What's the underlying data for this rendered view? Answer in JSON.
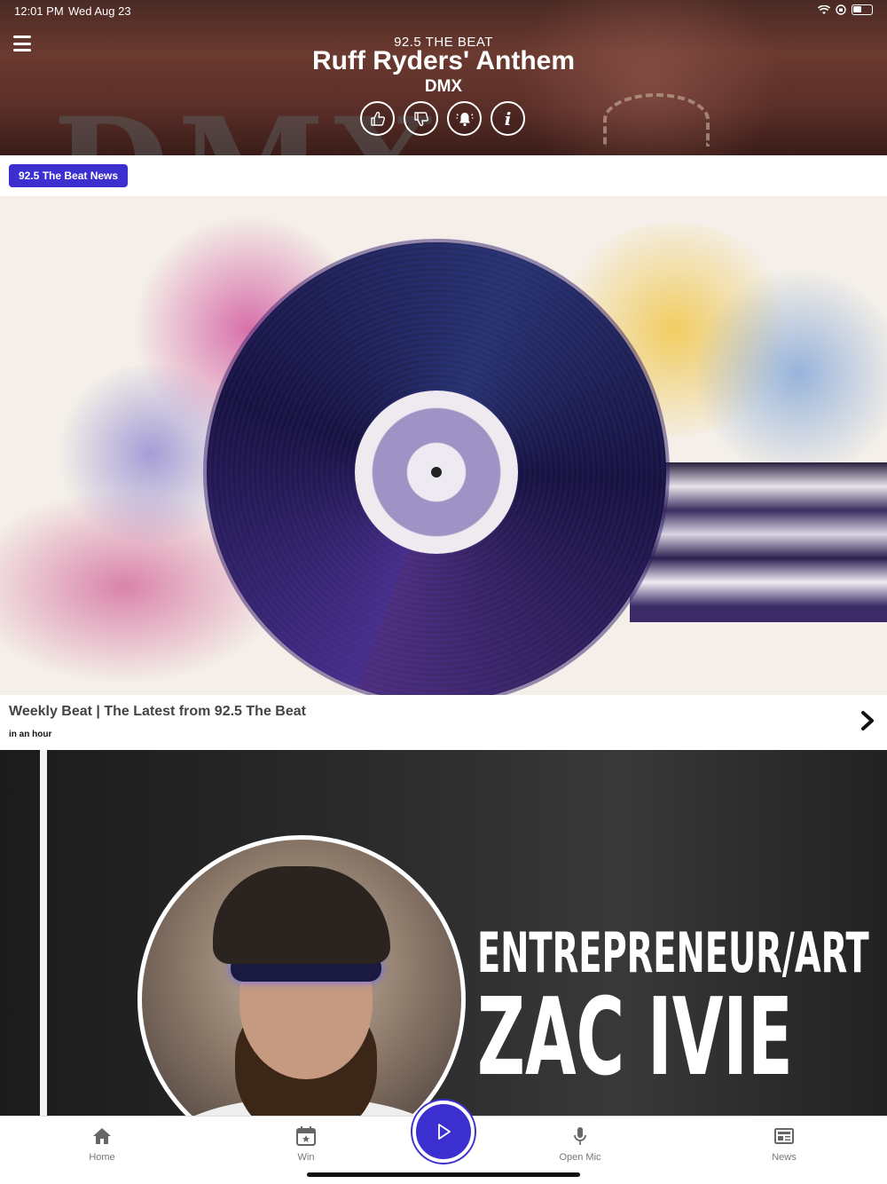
{
  "status_bar": {
    "time": "12:01 PM",
    "date": "Wed Aug 23"
  },
  "now_playing": {
    "station": "92.5 THE BEAT",
    "song": "Ruff Ryders' Anthem",
    "artist": "DMX",
    "background_art_text": "DMX"
  },
  "section": {
    "tag_label": "92.5 The Beat News"
  },
  "articles": [
    {
      "title": "Weekly Beat | The Latest from 92.5 The Beat",
      "time": "in an hour"
    },
    {
      "image_text_line1": "ENTREPRENEUR/ART",
      "image_text_line2": "ZAC IVIE"
    }
  ],
  "tabs": [
    {
      "label": "Home",
      "icon": "home-icon"
    },
    {
      "label": "Win",
      "icon": "calendar-star-icon"
    },
    {
      "label": "Open Mic",
      "icon": "microphone-icon"
    },
    {
      "label": "News",
      "icon": "newspaper-icon"
    }
  ],
  "colors": {
    "accent": "#3b2fd0",
    "header_bg": "#5a2e28"
  }
}
